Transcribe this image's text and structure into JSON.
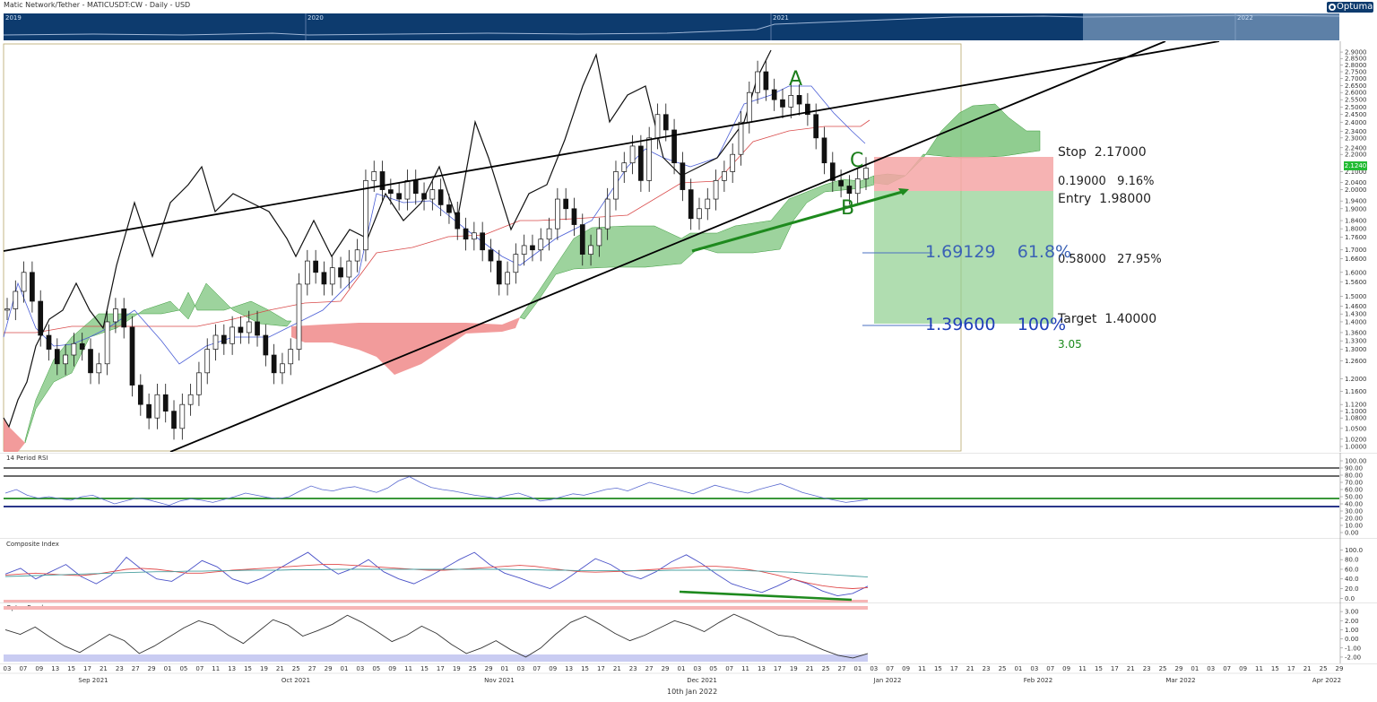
{
  "header": {
    "title": "Matic Network/Tether - MATICUSDT:CW - Daily - USD",
    "logo": "Optuma",
    "overview_years": [
      "2019",
      "2020",
      "2021",
      "2022"
    ]
  },
  "chart_data": [
    {
      "type": "candlestick",
      "title": "Matic Network/Tether - MATICUSDT:CW - Daily - USD",
      "y_scale": "log",
      "ylim": [
        1.0,
        2.95
      ],
      "y_ticks": [
        "2.9000",
        "2.8500",
        "2.8000",
        "2.7500",
        "2.7000",
        "2.6500",
        "2.6000",
        "2.5500",
        "2.5000",
        "2.4500",
        "2.4000",
        "2.3400",
        "2.3000",
        "2.2400",
        "2.2000",
        "2.1000",
        "2.0400",
        "2.0000",
        "1.9400",
        "1.9000",
        "1.8400",
        "1.8000",
        "1.7600",
        "1.7000",
        "1.6600",
        "1.6000",
        "1.5600",
        "1.5000",
        "1.4600",
        "1.4300",
        "1.4000",
        "1.3600",
        "1.3300",
        "1.3000",
        "1.2600",
        "1.2000",
        "1.1600",
        "1.1200",
        "1.1000",
        "1.0800",
        "1.0500",
        "1.0200",
        "1.0000"
      ],
      "last_price": "2.1240",
      "annotations": {
        "stop": {
          "label": "Stop",
          "value": "2.17000"
        },
        "risk": {
          "amount": "0.19000",
          "percent": "9.16%"
        },
        "entry": {
          "label": "Entry",
          "value": "1.98000"
        },
        "fib_618": {
          "value": "1.69129",
          "percent": "61.8%"
        },
        "reward": {
          "amount": "0.58000",
          "percent": "27.95%"
        },
        "target": {
          "label": "Target",
          "value": "1.40000"
        },
        "fib_100": {
          "value": "1.39600",
          "percent": "100%"
        },
        "reward_risk_ratio": "3.05",
        "waves": [
          "A",
          "B",
          "C"
        ]
      },
      "close_series_approx": [
        1.45,
        1.52,
        1.6,
        1.48,
        1.35,
        1.3,
        1.25,
        1.28,
        1.32,
        1.3,
        1.22,
        1.25,
        1.4,
        1.45,
        1.38,
        1.18,
        1.12,
        1.08,
        1.15,
        1.1,
        1.05,
        1.12,
        1.15,
        1.22,
        1.3,
        1.35,
        1.32,
        1.38,
        1.36,
        1.4,
        1.35,
        1.28,
        1.22,
        1.25,
        1.3,
        1.55,
        1.65,
        1.6,
        1.55,
        1.62,
        1.58,
        1.65,
        1.7,
        2.05,
        2.1,
        2.0,
        1.98,
        1.95,
        2.05,
        1.98,
        1.95,
        2.0,
        1.92,
        1.88,
        1.8,
        1.75,
        1.78,
        1.7,
        1.65,
        1.55,
        1.6,
        1.68,
        1.72,
        1.7,
        1.75,
        1.8,
        1.95,
        1.9,
        1.82,
        1.68,
        1.72,
        1.8,
        1.95,
        2.1,
        2.15,
        2.25,
        2.05,
        2.3,
        2.45,
        2.35,
        2.15,
        2.0,
        1.85,
        1.9,
        1.95,
        2.05,
        2.1,
        2.2,
        2.4,
        2.6,
        2.75,
        2.62,
        2.55,
        2.5,
        2.58,
        2.52,
        2.45,
        2.3,
        2.15,
        2.05,
        2.02,
        1.98,
        2.06,
        2.12
      ]
    },
    {
      "type": "line",
      "title": "14 Period RSI",
      "ylim": [
        0,
        100
      ],
      "y_ticks": [
        "100.00",
        "90.00",
        "80.00",
        "70.00",
        "60.00",
        "50.00",
        "40.00",
        "30.00",
        "20.00",
        "10.00",
        "0.00"
      ],
      "reference_levels": [
        90,
        80,
        50,
        40
      ],
      "series": [
        {
          "values": [
            55,
            60,
            52,
            48,
            50,
            47,
            45,
            50,
            52,
            46,
            40,
            44,
            48,
            46,
            42,
            38,
            44,
            47,
            45,
            42,
            46,
            50,
            55,
            52,
            49,
            47,
            50,
            58,
            65,
            60,
            58,
            62,
            64,
            60,
            56,
            62,
            72,
            78,
            70,
            63,
            60,
            58,
            55,
            52,
            50,
            48,
            52,
            55,
            50,
            44,
            46,
            50,
            54,
            52,
            56,
            60,
            62,
            58,
            64,
            70,
            66,
            62,
            58,
            54,
            60,
            66,
            62,
            58,
            55,
            60,
            64,
            68,
            62,
            56,
            52,
            48,
            45,
            42,
            44,
            46
          ]
        }
      ]
    },
    {
      "type": "line",
      "title": "Composite Index",
      "ylim": [
        -5,
        110
      ],
      "y_ticks": [
        "100.0",
        "80.0",
        "60.0",
        "40.0",
        "20.0",
        "0.0"
      ],
      "series": [
        {
          "values": [
            50,
            62,
            40,
            55,
            70,
            45,
            30,
            48,
            85,
            60,
            40,
            35,
            55,
            78,
            65,
            40,
            30,
            42,
            60,
            78,
            95,
            70,
            50,
            62,
            80,
            55,
            40,
            30,
            45,
            62,
            80,
            95,
            70,
            52,
            42,
            30,
            20,
            38,
            60,
            82,
            70,
            50,
            40,
            55,
            75,
            90,
            72,
            50,
            30,
            20,
            12,
            25,
            40,
            30,
            15,
            5,
            10,
            25
          ]
        },
        {
          "values": [
            48,
            50,
            52,
            50,
            48,
            47,
            50,
            55,
            60,
            62,
            60,
            56,
            52,
            52,
            55,
            58,
            60,
            62,
            64,
            66,
            68,
            70,
            70,
            68,
            66,
            64,
            62,
            60,
            58,
            58,
            60,
            62,
            64,
            66,
            68,
            66,
            62,
            58,
            55,
            54,
            55,
            56,
            58,
            60,
            62,
            64,
            66,
            66,
            64,
            60,
            55,
            48,
            40,
            32,
            26,
            22,
            20,
            22
          ]
        },
        {
          "values": [
            45,
            46,
            47,
            48,
            49,
            50,
            51,
            52,
            53,
            54,
            55,
            55,
            56,
            56,
            57,
            57,
            58,
            58,
            58,
            59,
            59,
            59,
            60,
            60,
            60,
            60,
            60,
            60,
            60,
            60,
            60,
            60,
            60,
            60,
            59,
            59,
            58,
            58,
            57,
            57,
            57,
            57,
            57,
            57,
            58,
            58,
            58,
            58,
            58,
            57,
            56,
            55,
            54,
            52,
            50,
            48,
            46,
            44
          ]
        }
      ]
    },
    {
      "type": "line",
      "title": "Optex Bands",
      "ylim": [
        -2.5,
        3.6
      ],
      "y_ticks": [
        "3.00",
        "2.00",
        "1.00",
        "0.00",
        "-1.00",
        "-2.00"
      ],
      "series": [
        {
          "values": [
            1.0,
            0.5,
            1.3,
            0.2,
            -0.8,
            -1.5,
            -0.5,
            0.5,
            -0.2,
            -1.6,
            -0.8,
            0.2,
            1.2,
            2.0,
            1.5,
            0.4,
            -0.5,
            0.8,
            2.1,
            1.5,
            0.3,
            0.9,
            1.6,
            2.6,
            1.8,
            0.8,
            -0.3,
            0.4,
            1.4,
            0.6,
            -0.6,
            -1.6,
            -1.0,
            -0.2,
            -1.2,
            -2.0,
            -1.0,
            0.5,
            1.8,
            2.5,
            1.6,
            0.6,
            -0.2,
            0.4,
            1.2,
            2.0,
            1.5,
            0.8,
            1.8,
            2.7,
            2.0,
            1.2,
            0.4,
            0.2,
            -0.5,
            -1.2,
            -1.8,
            -2.1,
            -1.6
          ]
        }
      ]
    }
  ],
  "rsi": {
    "label": "14 Period RSI"
  },
  "composite": {
    "label": "Composite Index"
  },
  "optex": {
    "label": "Optex Bands"
  },
  "x_axis": {
    "ticks": [
      "03",
      "07",
      "09",
      "13",
      "15",
      "17",
      "21",
      "23",
      "27",
      "29",
      "01",
      "05",
      "07",
      "11",
      "13",
      "15",
      "19",
      "21",
      "25",
      "27",
      "29",
      "01",
      "03",
      "05",
      "09",
      "11",
      "15",
      "17",
      "19",
      "25",
      "29",
      "01",
      "03",
      "07",
      "09",
      "13",
      "15",
      "17",
      "21",
      "23",
      "27",
      "29",
      "01",
      "03",
      "05",
      "07",
      "11",
      "13",
      "17",
      "19",
      "21",
      "25",
      "27",
      "01",
      "03",
      "07",
      "09",
      "11",
      "15",
      "17",
      "21",
      "23",
      "25",
      "01",
      "03",
      "07",
      "09",
      "11",
      "15",
      "17",
      "21",
      "23",
      "25",
      "29",
      "01",
      "03",
      "07",
      "09",
      "11",
      "15",
      "17",
      "21",
      "25",
      "29"
    ],
    "months": [
      "Sep 2021",
      "Oct 2021",
      "Nov 2021",
      "Dec 2021",
      "Jan 2022",
      "Feb 2022",
      "Mar 2022",
      "Apr 2022"
    ],
    "footer_date": "10th Jan 2022"
  }
}
